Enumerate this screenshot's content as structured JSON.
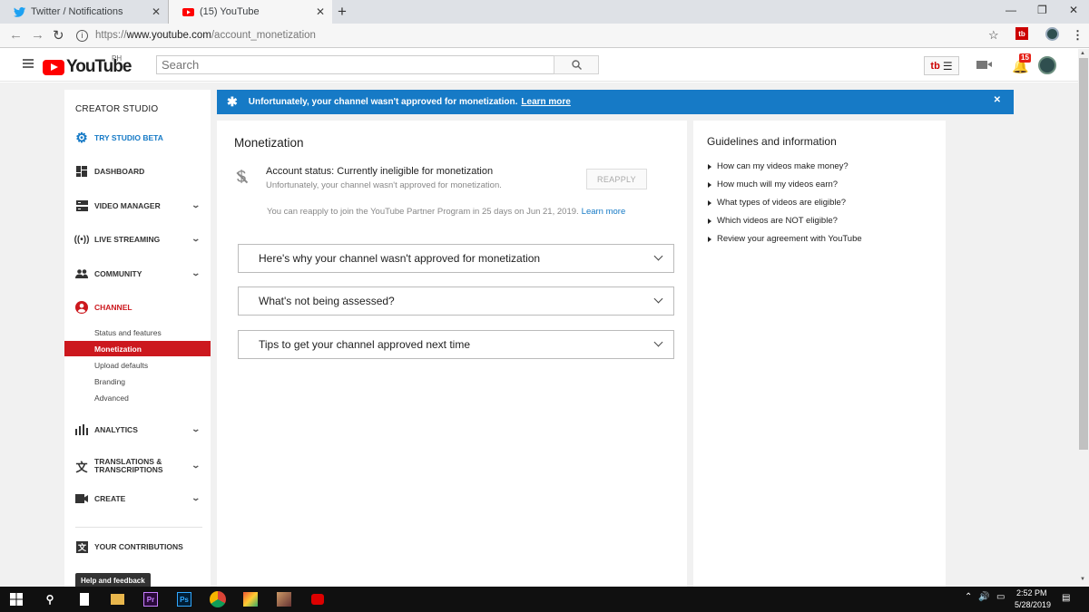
{
  "browser": {
    "tabs": [
      {
        "title": "Twitter / Notifications",
        "favicon": "twitter-bird-icon"
      },
      {
        "title": "(15) YouTube",
        "favicon": "youtube-icon"
      }
    ],
    "url_prefix": "https://",
    "url_host": "www.youtube.com",
    "url_path": "/account_monetization"
  },
  "header": {
    "logo_text": "YouTube",
    "country_code": "PH",
    "search_placeholder": "Search",
    "notification_count": "15"
  },
  "sidebar": {
    "title": "CREATOR STUDIO",
    "items": [
      {
        "label": "TRY STUDIO BETA",
        "icon": "gear-icon"
      },
      {
        "label": "DASHBOARD",
        "icon": "dashboard-icon"
      },
      {
        "label": "VIDEO MANAGER",
        "icon": "video-manager-icon"
      },
      {
        "label": "LIVE STREAMING",
        "icon": "live-icon"
      },
      {
        "label": "COMMUNITY",
        "icon": "people-icon"
      },
      {
        "label": "CHANNEL",
        "icon": "account-circle-icon"
      },
      {
        "label": "ANALYTICS",
        "icon": "bar-chart-icon"
      },
      {
        "label": "TRANSLATIONS &",
        "label2": "TRANSCRIPTIONS",
        "icon": "translate-icon"
      },
      {
        "label": "CREATE",
        "icon": "camera-icon"
      },
      {
        "label": "YOUR CONTRIBUTIONS",
        "icon": "contributions-icon"
      }
    ],
    "channel_subitems": [
      "Status and features",
      "Monetization",
      "Upload defaults",
      "Branding",
      "Advanced"
    ],
    "help_tooltip": "Help and feedback"
  },
  "banner": {
    "message": "Unfortunately, your channel wasn't approved for monetization.",
    "link": "Learn more"
  },
  "main": {
    "title": "Monetization",
    "account_status": "Account status: Currently ineligible for monetization",
    "account_sub": "Unfortunately, your channel wasn't approved for monetization.",
    "reapply_button": "REAPPLY",
    "reapply_note": "You can reapply to join the YouTube Partner Program in 25 days on Jun 21, 2019.",
    "reapply_link": "Learn more",
    "accordions": [
      "Here's why your channel wasn't approved for monetization",
      "What's not being assessed?",
      "Tips to get your channel approved next time"
    ]
  },
  "guidelines": {
    "title": "Guidelines and information",
    "items": [
      "How can my videos make money?",
      "How much will my videos earn?",
      "What types of videos are eligible?",
      "Which videos are NOT eligible?",
      "Review your agreement with YouTube"
    ]
  },
  "taskbar": {
    "time": "2:52 PM",
    "date": "5/28/2019",
    "app_labels": [
      "Pr",
      "Ps"
    ]
  },
  "colors": {
    "banner_blue": "#167ac6",
    "youtube_red": "#cc181e",
    "link_blue": "#167ac6"
  }
}
